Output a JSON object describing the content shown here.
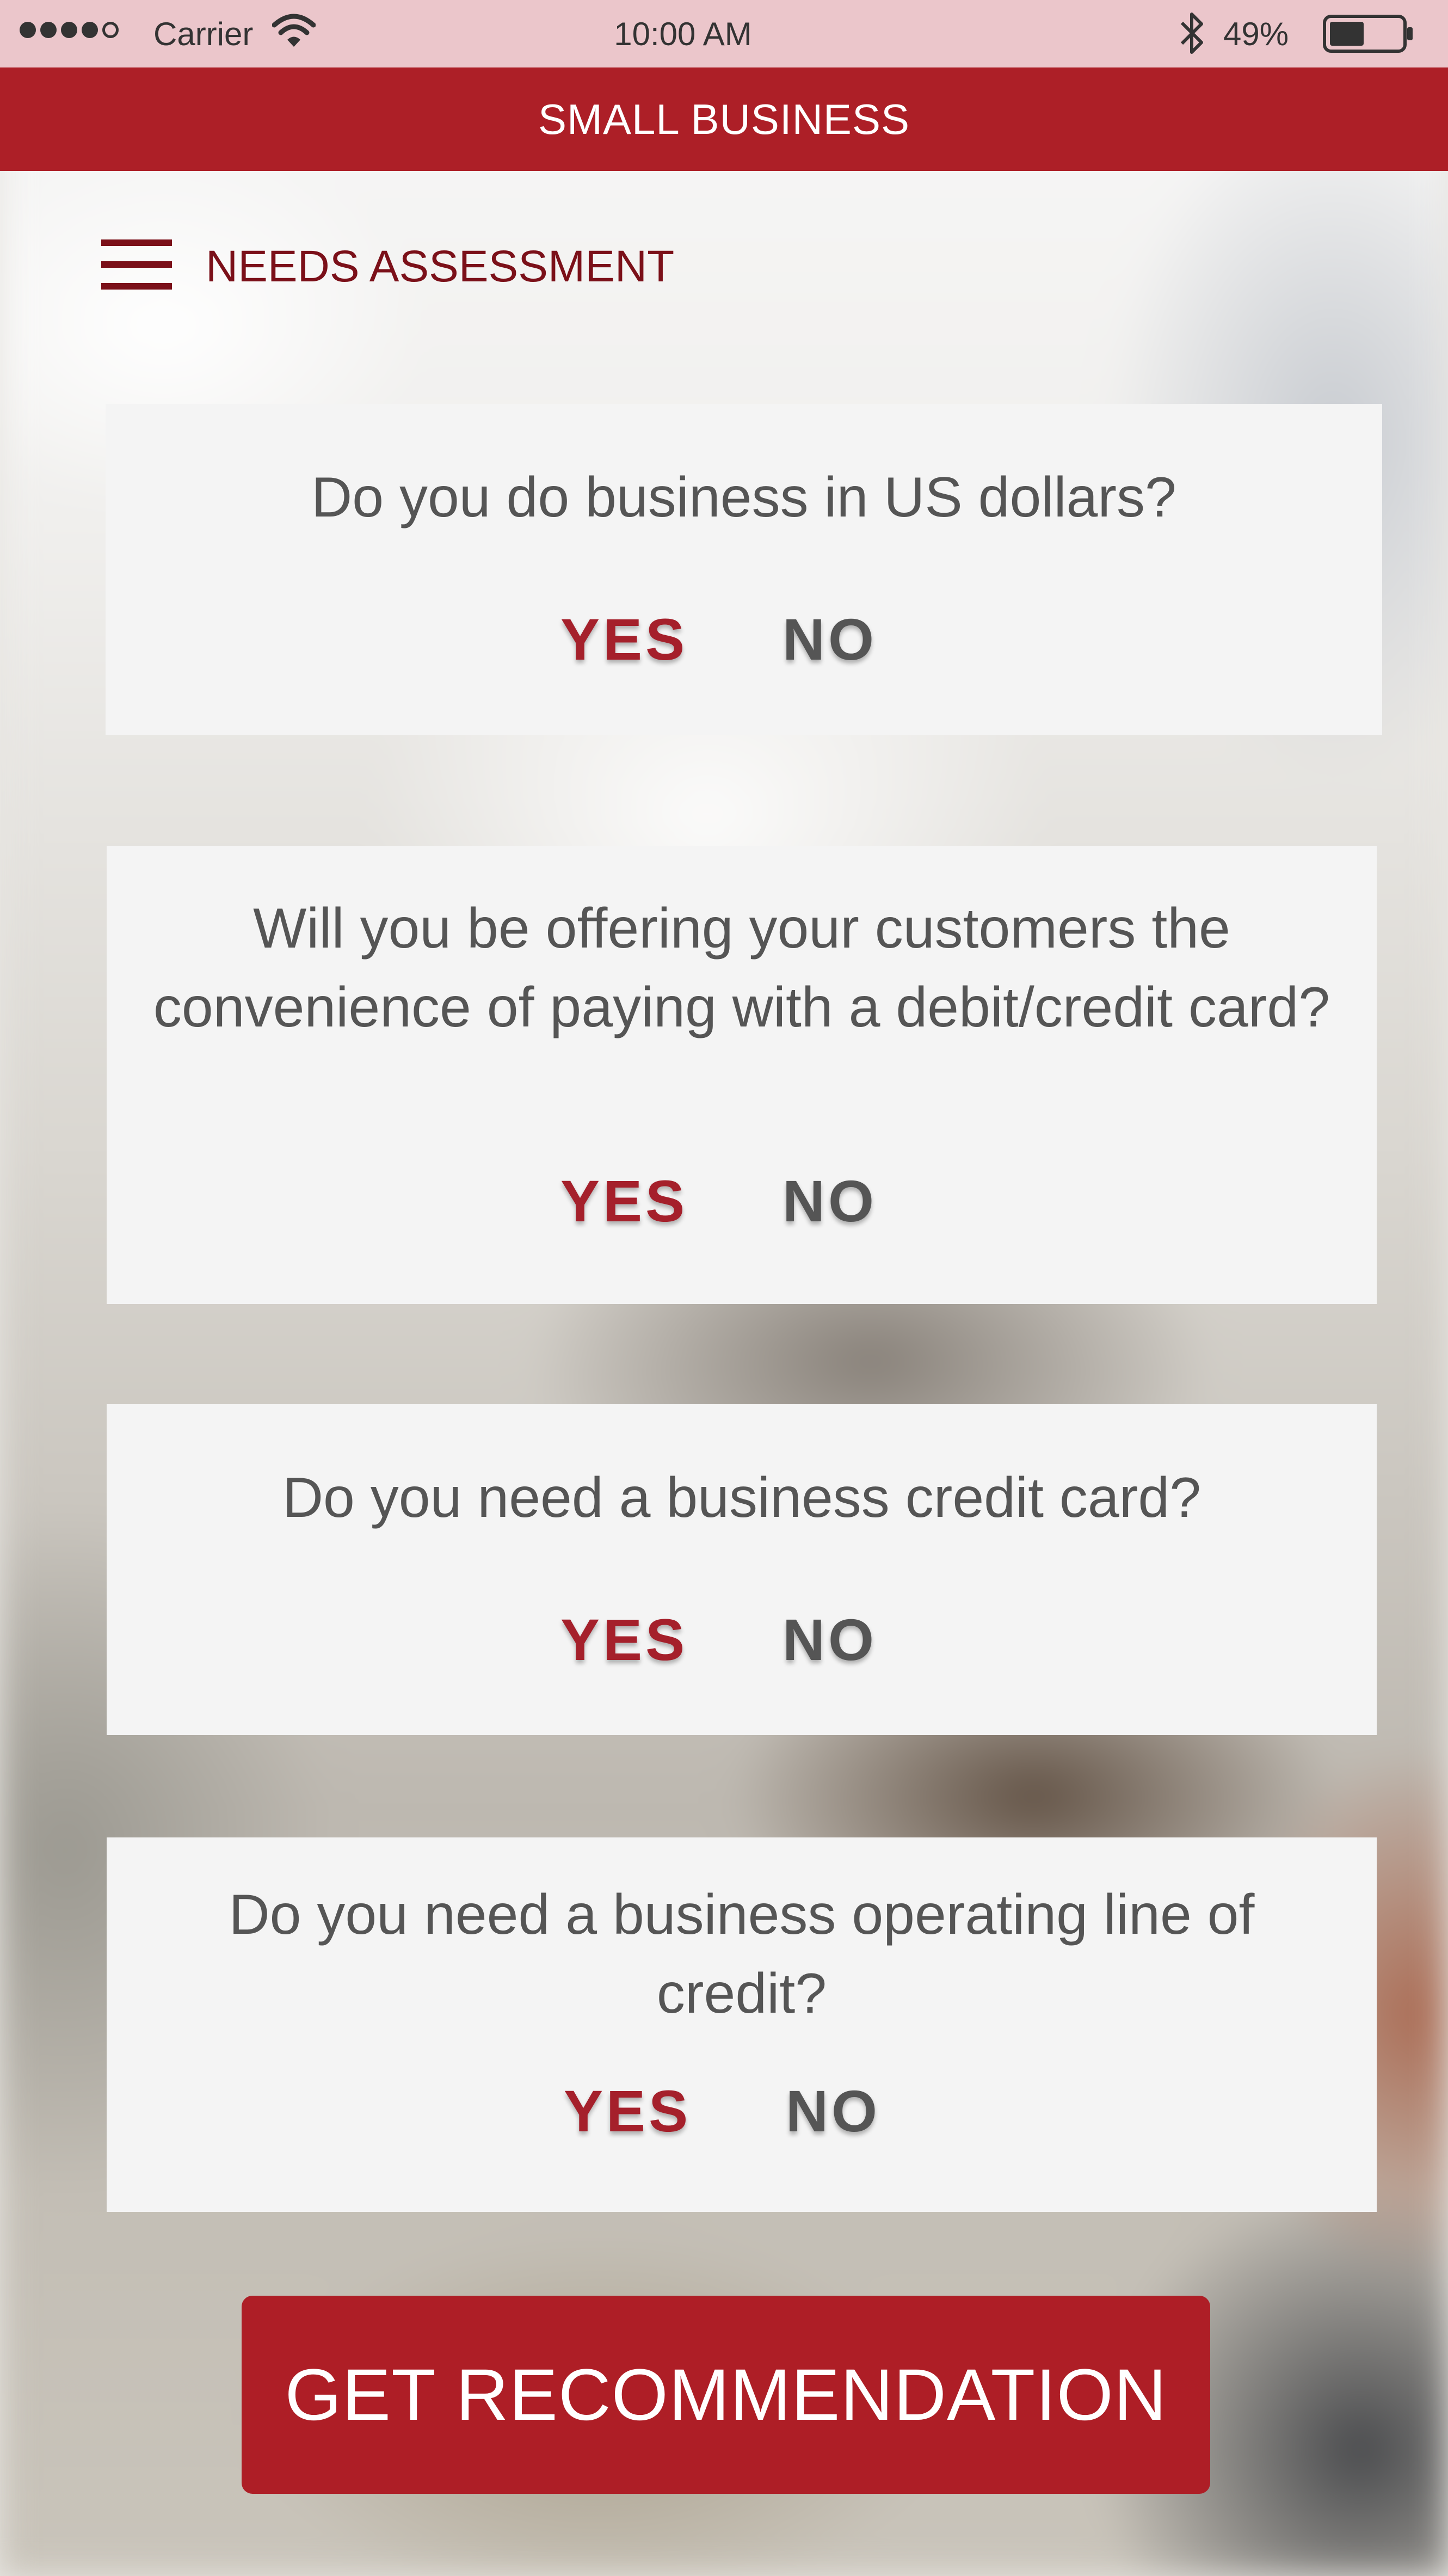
{
  "status_bar": {
    "carrier": "Carrier",
    "time": "10:00 AM",
    "battery_percent": "49%",
    "signal_bars_filled": 4,
    "signal_bars_total": 5,
    "battery_level": 0.49
  },
  "header": {
    "title": "SMALL BUSINESS"
  },
  "page": {
    "title": "NEEDS ASSESSMENT"
  },
  "questions": [
    {
      "text": "Do you do business in US dollars?",
      "yes_label": "YES",
      "no_label": "NO"
    },
    {
      "text": "Will you be offering your customers the convenience of paying with a debit/credit card?",
      "yes_label": "YES",
      "no_label": "NO"
    },
    {
      "text": "Do you need a business credit card?",
      "yes_label": "YES",
      "no_label": "NO"
    },
    {
      "text": "Do you need a business operating line of credit?",
      "yes_label": "YES",
      "no_label": "NO"
    }
  ],
  "cta": {
    "label": "GET RECOMMENDATION"
  },
  "colors": {
    "brand_red": "#ad1f27",
    "status_bar_pink": "#ebc6cb",
    "dark_red_text": "#7b1019",
    "card_bg": "#f4f4f4",
    "text_gray": "#555555"
  }
}
